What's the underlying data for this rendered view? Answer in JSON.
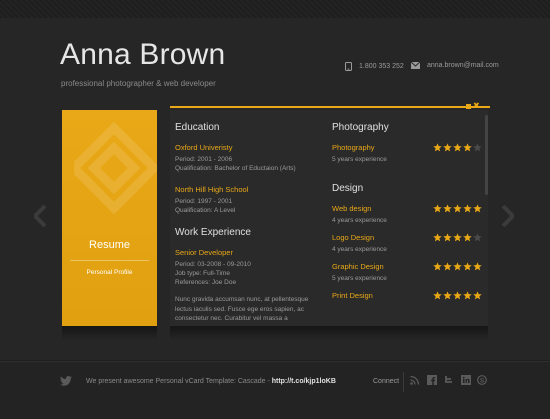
{
  "header": {
    "name": "Anna Brown",
    "subtitle": "professional photographer & web developer",
    "phone": "1.800 353 252",
    "email": "anna.brown@mail.com"
  },
  "card": {
    "title": "Resume",
    "subtitle": "Personal Profile"
  },
  "education": {
    "title": "Education",
    "items": [
      {
        "name": "Oxford Univeristy",
        "period": "Period: 2001 - 2006",
        "detail": "Qualification: Bachelor of Eductaion (Arts)"
      },
      {
        "name": "North Hill High School",
        "period": "Period: 1997 - 2001",
        "detail": "Qualification: A Level"
      }
    ]
  },
  "work": {
    "title": "Work Experience",
    "items": [
      {
        "name": "Senior Developer",
        "period": "Period: 03-2008 - 09-2010",
        "type": "Job type: Full-Time",
        "references": "References: Joe Doe"
      }
    ],
    "paragraph": "Nunc gravida accumsan nunc, at pellentesque lectus iaculis sed. Fusce ege eros sapien, ac consectetur nec. Curabitur vel massa a"
  },
  "photography": {
    "title": "Photography",
    "skills": [
      {
        "name": "Photography",
        "experience": "5 years experience",
        "rating": 4
      }
    ]
  },
  "design": {
    "title": "Design",
    "skills": [
      {
        "name": "Web design",
        "experience": "4 years experience",
        "rating": 5
      },
      {
        "name": "Logo Design",
        "experience": "4 years experience",
        "rating": 4
      },
      {
        "name": "Graphic Design",
        "experience": "5 years experience",
        "rating": 5
      },
      {
        "name": "Print Design",
        "experience": "",
        "rating": 5
      }
    ]
  },
  "footer": {
    "text": "We present awesome Personal vCard Template: Cascade - ",
    "link": "http://t.co/kjp1loKB",
    "connect": "Connect"
  },
  "icons": [
    "phone-icon",
    "mail-icon",
    "arrow-left-icon",
    "arrow-right-icon",
    "twitter-icon",
    "rss-icon",
    "facebook-icon",
    "twitter-icon",
    "linkedin-icon",
    "skype-icon"
  ],
  "colors": {
    "accent": "#e9a817",
    "background": "#262626",
    "panel": "#2a2a2a"
  }
}
